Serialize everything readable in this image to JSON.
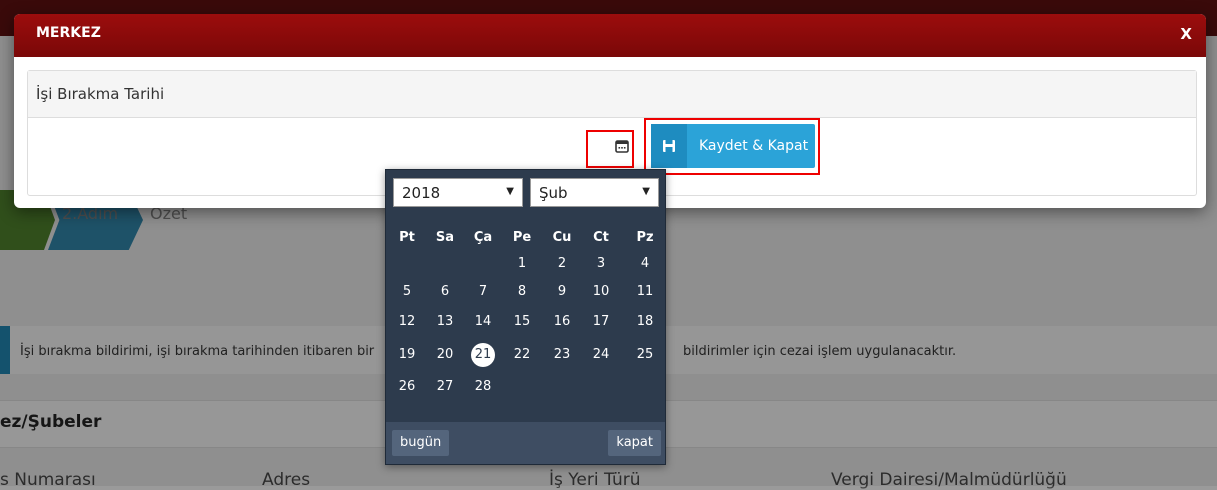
{
  "background": {
    "steps": [
      "2.Adım",
      "Özet"
    ],
    "info_left": "İşi bırakma bildirimi, işi bırakma tarihinden itibaren bir",
    "info_right": "bildirimler için cezai işlem uygulanacaktır.",
    "section_title": "ez/Şubeler",
    "columns": [
      "s Numarası",
      "Adres",
      "İş Yeri Türü",
      "Vergi Dairesi/Malmüdürlüğü"
    ]
  },
  "modal": {
    "title": "MERKEZ",
    "close_label": "X",
    "panel_title": "İşi Bırakma Tarihi",
    "save_label": "Kaydet & Kapat"
  },
  "datepicker": {
    "year": "2018",
    "month": "Şub",
    "weekdays": [
      "Pt",
      "Sa",
      "Ça",
      "Pe",
      "Cu",
      "Ct",
      "Pz"
    ],
    "weeks": [
      [
        "",
        "",
        "",
        "1",
        "2",
        "3",
        "4"
      ],
      [
        "5",
        "6",
        "7",
        "8",
        "9",
        "10",
        "11"
      ],
      [
        "12",
        "13",
        "14",
        "15",
        "16",
        "17",
        "18"
      ],
      [
        "19",
        "20",
        "21",
        "22",
        "23",
        "24",
        "25"
      ],
      [
        "26",
        "27",
        "28",
        "",
        "",
        "",
        ""
      ]
    ],
    "selected_day": "21",
    "today_label": "bugün",
    "close_label": "kapat"
  },
  "colors": {
    "header_red": "#8b0a0a",
    "accent_blue": "#2ba3d8",
    "picker_bg": "#2d3b4d",
    "highlight": "#e00000"
  },
  "icons": {
    "calendar": "calendar-icon",
    "save": "floppy-disk-icon"
  }
}
